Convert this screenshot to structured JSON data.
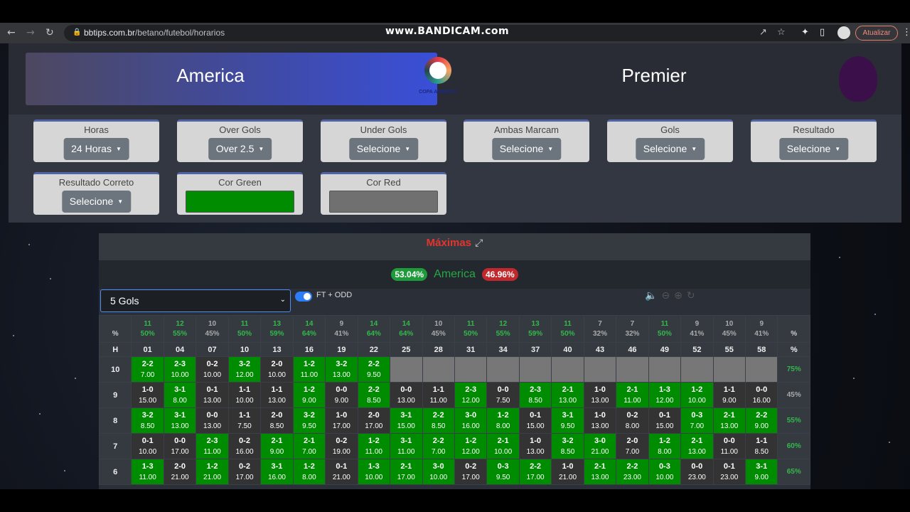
{
  "browser": {
    "url_host": "bbtips.com.br",
    "url_path": "/betano/futebol/horarios",
    "watermark": "www.BANDICAM.com",
    "update_label": "Atualizar"
  },
  "banners": {
    "left": "America",
    "left_logo_text": "COPA AMERICA",
    "right": "Premier"
  },
  "filters": [
    {
      "label": "Horas",
      "value": "24 Horas"
    },
    {
      "label": "Over Gols",
      "value": "Over 2.5"
    },
    {
      "label": "Under Gols",
      "value": "Selecione"
    },
    {
      "label": "Ambas Marcam",
      "value": "Selecione"
    },
    {
      "label": "Gols",
      "value": "Selecione"
    },
    {
      "label": "Resultado",
      "value": "Selecione"
    },
    {
      "label": "Resultado Correto",
      "value": "Selecione"
    }
  ],
  "colors": {
    "label_green": "Cor Green",
    "label_red": "Cor Red",
    "green": "#008c00",
    "red": "#707070"
  },
  "maximas": {
    "title": "Máximas",
    "green_pct": "53.04%",
    "name": "America",
    "red_pct": "46.96%"
  },
  "controls": {
    "select_value": "5 Gols",
    "toggle_label": "FT + ODD"
  },
  "grid": {
    "col_counts": [
      "11",
      "12",
      "10",
      "11",
      "13",
      "14",
      "9",
      "14",
      "14",
      "10",
      "11",
      "12",
      "13",
      "11",
      "7",
      "7",
      "11",
      "9",
      "10",
      "9"
    ],
    "col_pcts": [
      "50%",
      "55%",
      "45%",
      "50%",
      "59%",
      "64%",
      "41%",
      "64%",
      "64%",
      "45%",
      "50%",
      "55%",
      "59%",
      "50%",
      "32%",
      "32%",
      "50%",
      "41%",
      "45%",
      "41%"
    ],
    "pct_label": "%",
    "h_label": "H",
    "minutes": [
      "01",
      "04",
      "07",
      "10",
      "13",
      "16",
      "19",
      "22",
      "25",
      "28",
      "31",
      "34",
      "37",
      "40",
      "43",
      "46",
      "49",
      "52",
      "55",
      "58"
    ],
    "rows": [
      {
        "h": "10",
        "pct": "75%",
        "cells": [
          [
            "2-2",
            "7.00",
            "G"
          ],
          [
            "2-3",
            "10.00",
            "G"
          ],
          [
            "0-2",
            "10.00",
            "R"
          ],
          [
            "3-2",
            "12.00",
            "G"
          ],
          [
            "2-0",
            "10.00",
            "R"
          ],
          [
            "1-2",
            "11.00",
            "G"
          ],
          [
            "3-2",
            "13.00",
            "G"
          ],
          [
            "2-2",
            "9.50",
            "G"
          ],
          [
            "",
            "",
            "E"
          ],
          [
            "",
            "",
            "E"
          ],
          [
            "",
            "",
            "E"
          ],
          [
            "",
            "",
            "E"
          ],
          [
            "",
            "",
            "E"
          ],
          [
            "",
            "",
            "E"
          ],
          [
            "",
            "",
            "E"
          ],
          [
            "",
            "",
            "E"
          ],
          [
            "",
            "",
            "E"
          ],
          [
            "",
            "",
            "E"
          ],
          [
            "",
            "",
            "E"
          ],
          [
            "",
            "",
            "E"
          ]
        ]
      },
      {
        "h": "9",
        "pct": "45%",
        "cells": [
          [
            "1-0",
            "15.00",
            "R"
          ],
          [
            "3-1",
            "8.00",
            "G"
          ],
          [
            "0-1",
            "13.00",
            "R"
          ],
          [
            "1-1",
            "10.00",
            "R"
          ],
          [
            "1-1",
            "13.00",
            "R"
          ],
          [
            "1-2",
            "9.00",
            "G"
          ],
          [
            "0-0",
            "9.00",
            "R"
          ],
          [
            "2-2",
            "8.50",
            "G"
          ],
          [
            "0-0",
            "13.00",
            "R"
          ],
          [
            "1-1",
            "11.00",
            "R"
          ],
          [
            "2-3",
            "12.00",
            "G"
          ],
          [
            "0-0",
            "7.50",
            "R"
          ],
          [
            "2-3",
            "8.50",
            "G"
          ],
          [
            "2-1",
            "13.00",
            "G"
          ],
          [
            "1-0",
            "13.00",
            "R"
          ],
          [
            "2-1",
            "11.00",
            "G"
          ],
          [
            "1-3",
            "12.00",
            "G"
          ],
          [
            "1-2",
            "10.00",
            "G"
          ],
          [
            "1-1",
            "9.00",
            "R"
          ],
          [
            "0-0",
            "16.00",
            "R"
          ]
        ]
      },
      {
        "h": "8",
        "pct": "55%",
        "cells": [
          [
            "3-2",
            "8.50",
            "G"
          ],
          [
            "3-1",
            "13.00",
            "G"
          ],
          [
            "0-0",
            "13.00",
            "R"
          ],
          [
            "1-1",
            "7.50",
            "R"
          ],
          [
            "2-0",
            "8.50",
            "R"
          ],
          [
            "3-2",
            "9.50",
            "G"
          ],
          [
            "1-0",
            "17.00",
            "R"
          ],
          [
            "2-0",
            "17.00",
            "R"
          ],
          [
            "3-1",
            "15.00",
            "G"
          ],
          [
            "2-2",
            "8.50",
            "G"
          ],
          [
            "3-0",
            "16.00",
            "G"
          ],
          [
            "1-2",
            "8.00",
            "G"
          ],
          [
            "0-1",
            "15.00",
            "R"
          ],
          [
            "3-1",
            "9.50",
            "G"
          ],
          [
            "1-0",
            "13.00",
            "R"
          ],
          [
            "0-2",
            "8.00",
            "R"
          ],
          [
            "0-1",
            "15.00",
            "R"
          ],
          [
            "0-3",
            "7.00",
            "G"
          ],
          [
            "2-1",
            "13.00",
            "G"
          ],
          [
            "2-2",
            "9.00",
            "G"
          ]
        ]
      },
      {
        "h": "7",
        "pct": "60%",
        "cells": [
          [
            "0-1",
            "10.00",
            "R"
          ],
          [
            "0-0",
            "17.00",
            "R"
          ],
          [
            "2-3",
            "11.00",
            "G"
          ],
          [
            "0-2",
            "16.00",
            "R"
          ],
          [
            "2-1",
            "9.00",
            "G"
          ],
          [
            "2-1",
            "7.00",
            "G"
          ],
          [
            "0-2",
            "19.00",
            "R"
          ],
          [
            "1-2",
            "11.00",
            "G"
          ],
          [
            "3-1",
            "11.00",
            "G"
          ],
          [
            "2-2",
            "7.00",
            "G"
          ],
          [
            "1-2",
            "12.00",
            "G"
          ],
          [
            "2-1",
            "10.00",
            "G"
          ],
          [
            "1-0",
            "13.00",
            "R"
          ],
          [
            "3-2",
            "8.50",
            "G"
          ],
          [
            "3-0",
            "21.00",
            "G"
          ],
          [
            "2-0",
            "7.00",
            "R"
          ],
          [
            "1-2",
            "8.00",
            "G"
          ],
          [
            "2-1",
            "13.00",
            "G"
          ],
          [
            "0-0",
            "11.00",
            "R"
          ],
          [
            "1-1",
            "8.50",
            "R"
          ]
        ]
      },
      {
        "h": "6",
        "pct": "65%",
        "cells": [
          [
            "1-3",
            "11.00",
            "G"
          ],
          [
            "2-0",
            "21.00",
            "R"
          ],
          [
            "1-2",
            "21.00",
            "G"
          ],
          [
            "0-2",
            "17.00",
            "R"
          ],
          [
            "3-1",
            "16.00",
            "G"
          ],
          [
            "1-2",
            "8.00",
            "G"
          ],
          [
            "0-1",
            "21.00",
            "R"
          ],
          [
            "1-3",
            "10.00",
            "G"
          ],
          [
            "2-1",
            "17.00",
            "G"
          ],
          [
            "3-0",
            "10.00",
            "G"
          ],
          [
            "0-2",
            "17.00",
            "R"
          ],
          [
            "0-3",
            "9.50",
            "G"
          ],
          [
            "2-2",
            "17.00",
            "G"
          ],
          [
            "1-0",
            "21.00",
            "R"
          ],
          [
            "2-1",
            "13.00",
            "G"
          ],
          [
            "2-2",
            "23.00",
            "G"
          ],
          [
            "0-3",
            "10.00",
            "G"
          ],
          [
            "0-0",
            "23.00",
            "R"
          ],
          [
            "0-1",
            "23.00",
            "R"
          ],
          [
            "3-1",
            "9.00",
            "G"
          ]
        ]
      }
    ]
  }
}
